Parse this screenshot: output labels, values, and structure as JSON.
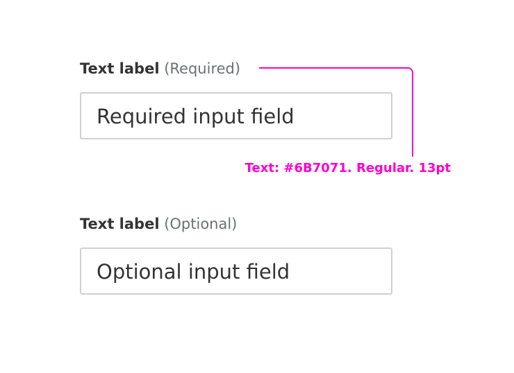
{
  "form": {
    "required": {
      "label": "Text label",
      "hint": "(Required)",
      "value": "Required input field"
    },
    "optional": {
      "label": "Text label",
      "hint": "(Optional)",
      "value": "Optional input field"
    }
  },
  "annotation": {
    "text": "Text: #6B7071. Regular. 13pt",
    "color": "#ff00cc"
  },
  "colors": {
    "hint_text": "#6B7071",
    "label_text": "#333333",
    "field_border": "#d0d0d0"
  }
}
